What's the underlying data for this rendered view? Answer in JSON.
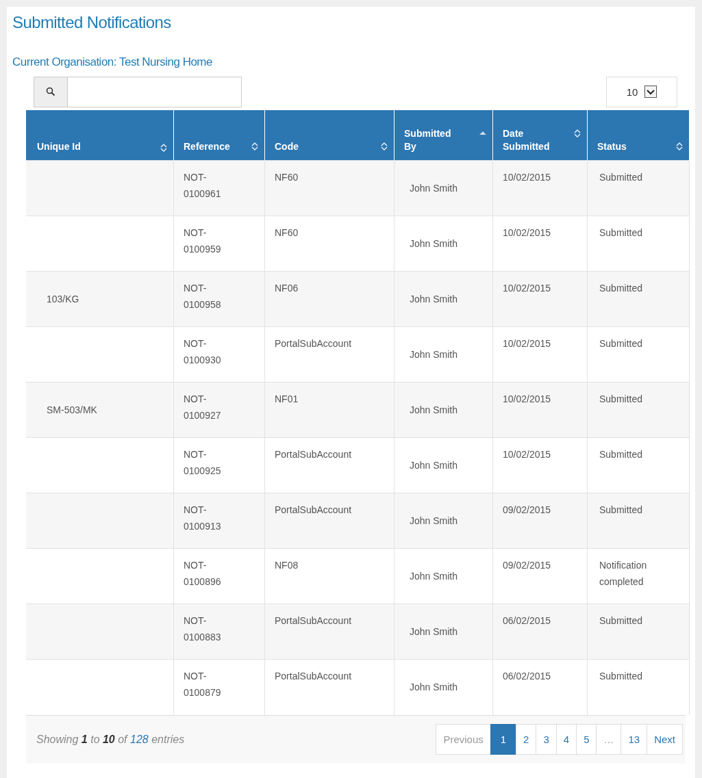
{
  "title": "Submitted Notifications",
  "organisation": "Current Organisation: Test Nursing Home",
  "page_size": {
    "value": "10"
  },
  "table": {
    "columns": [
      {
        "label": "Unique Id",
        "sorted_ascending": false
      },
      {
        "label": "Reference",
        "sorted_ascending": false
      },
      {
        "label": "Code",
        "sorted_ascending": false
      },
      {
        "label": "Submitted By",
        "sorted_ascending": true
      },
      {
        "label": "Date Submitted",
        "sorted_ascending": false
      },
      {
        "label": "Status",
        "sorted_ascending": false
      }
    ],
    "rows": [
      [
        "",
        "NOT-0100961",
        "NF60",
        "John Smith",
        "10/02/2015",
        "Submitted"
      ],
      [
        "",
        "NOT-0100959",
        "NF60",
        "John Smith",
        "10/02/2015",
        "Submitted"
      ],
      [
        "103/KG",
        "NOT-0100958",
        "NF06",
        "John Smith",
        "10/02/2015",
        "Submitted"
      ],
      [
        "",
        "NOT-0100930",
        "PortalSubAccount",
        "John Smith",
        "10/02/2015",
        "Submitted"
      ],
      [
        "SM-503/MK",
        "NOT-0100927",
        "NF01",
        "John Smith",
        "10/02/2015",
        "Submitted"
      ],
      [
        "",
        "NOT-0100925",
        "PortalSubAccount",
        "John Smith",
        "10/02/2015",
        "Submitted"
      ],
      [
        "",
        "NOT-0100913",
        "PortalSubAccount",
        "John Smith",
        "09/02/2015",
        "Submitted"
      ],
      [
        "",
        "NOT-0100896",
        "NF08",
        "John Smith",
        "09/02/2015",
        "Notification completed"
      ],
      [
        "",
        "NOT-0100883",
        "PortalSubAccount",
        "John Smith",
        "06/02/2015",
        "Submitted"
      ],
      [
        "",
        "NOT-0100879",
        "PortalSubAccount",
        "John Smith",
        "06/02/2015",
        "Submitted"
      ]
    ]
  },
  "info": [
    {
      "text": "Showing ",
      "kind": "plain"
    },
    {
      "text": "1",
      "kind": "bold"
    },
    {
      "text": " to ",
      "kind": "plain"
    },
    {
      "text": "10",
      "kind": "bold"
    },
    {
      "text": " of ",
      "kind": "plain"
    },
    {
      "text": "128",
      "kind": "link"
    },
    {
      "text": " entries",
      "kind": "plain"
    }
  ],
  "pagination": [
    {
      "label": "Previous",
      "selected": false,
      "disabled": true
    },
    {
      "label": "1",
      "selected": true,
      "disabled": false
    },
    {
      "label": "2",
      "selected": false,
      "disabled": false
    },
    {
      "label": "3",
      "selected": false,
      "disabled": false
    },
    {
      "label": "4",
      "selected": false,
      "disabled": false
    },
    {
      "label": "5",
      "selected": false,
      "disabled": false
    },
    {
      "label": "…",
      "selected": false,
      "disabled": true
    },
    {
      "label": "13",
      "selected": false,
      "disabled": false
    },
    {
      "label": "Next",
      "selected": false,
      "disabled": false
    }
  ]
}
